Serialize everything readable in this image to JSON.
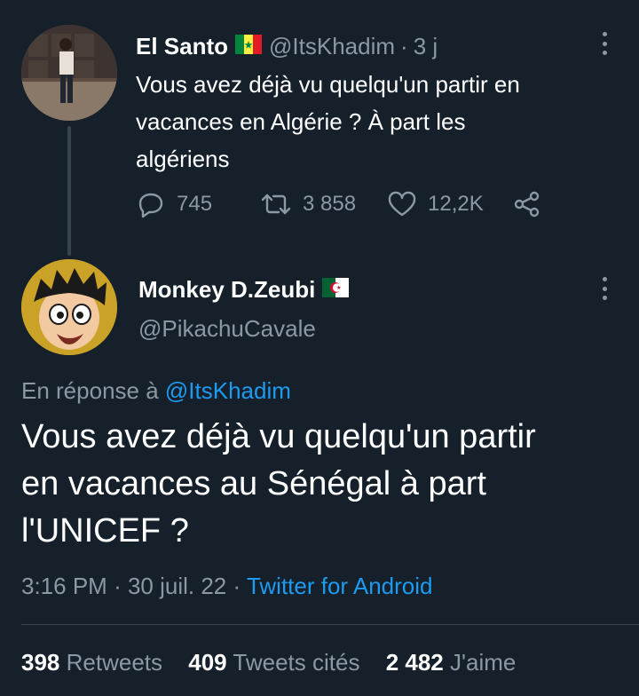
{
  "parent_tweet": {
    "name": "El Santo",
    "flag": "senegal-flag",
    "handle": "@ItsKhadim",
    "separator": "·",
    "time": "3 j",
    "text_lines": [
      "Vous avez déjà vu quelqu'un partir en",
      "vacances en Algérie ? À part les",
      "algériens"
    ],
    "replies": "745",
    "retweets": "3 858",
    "likes": "12,2K"
  },
  "main_tweet": {
    "name": "Monkey D.Zeubi",
    "flag": "algeria-flag",
    "handle": "@PikachuCavale",
    "reply_prefix": "En réponse à",
    "reply_mention": "@ItsKhadim",
    "text_lines": [
      "Vous avez déjà vu quelqu'un partir",
      "en vacances au Sénégal à part",
      "l'UNICEF ?"
    ],
    "time": "3:16 PM",
    "separator": "·",
    "date": "30 juil. 22",
    "source": "Twitter for Android",
    "retweets_count": "398",
    "retweets_label": "Retweets",
    "quotes_count": "409",
    "quotes_label": "Tweets cités",
    "likes_count": "2 482",
    "likes_label": "J'aime"
  },
  "colors": {
    "background": "#15202b",
    "secondary_text": "#8b98a5",
    "accent": "#1d9bf0",
    "divider": "#38444d"
  }
}
